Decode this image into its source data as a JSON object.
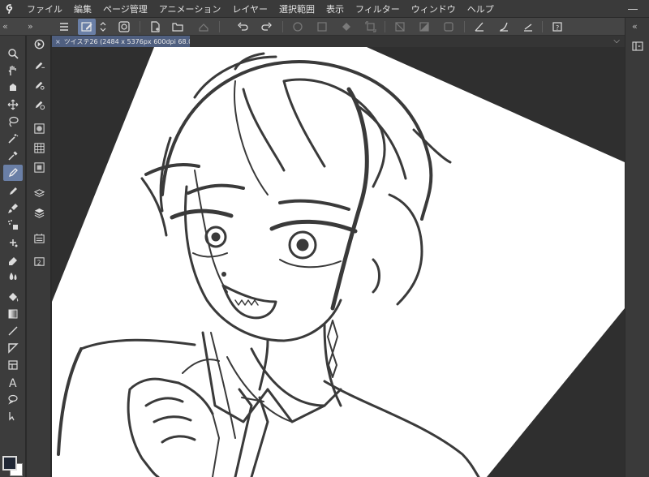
{
  "menu": {
    "items": [
      "ファイル",
      "編集",
      "ページ管理",
      "アニメーション",
      "レイヤー",
      "選択範囲",
      "表示",
      "フィルター",
      "ウィンドウ",
      "ヘルプ"
    ]
  },
  "document": {
    "tab_title": "ツイステ26 (2484 x 5376px 600dpi 68.0%)",
    "close_glyph": "×",
    "menu_glyph": "⌵"
  },
  "colors": {
    "main_color": "#1f2634",
    "sub_color": "#ffffff",
    "accent": "#6a7fa6"
  },
  "icons": {
    "app": "clip-studio-logo-icon",
    "tools": [
      "zoom-icon",
      "hand-icon",
      "rotate-icon",
      "move-icon",
      "lasso-icon",
      "magic-wand-icon",
      "eyedropper-icon",
      "pen-icon",
      "pencil-icon",
      "brush-icon",
      "airbrush-icon",
      "decoration-icon",
      "eraser-icon",
      "blend-icon",
      "fill-icon",
      "gradient-icon",
      "line-icon",
      "frame-icon",
      "ruler-icon",
      "text-icon",
      "balloon-icon",
      "correct-line-icon"
    ]
  }
}
